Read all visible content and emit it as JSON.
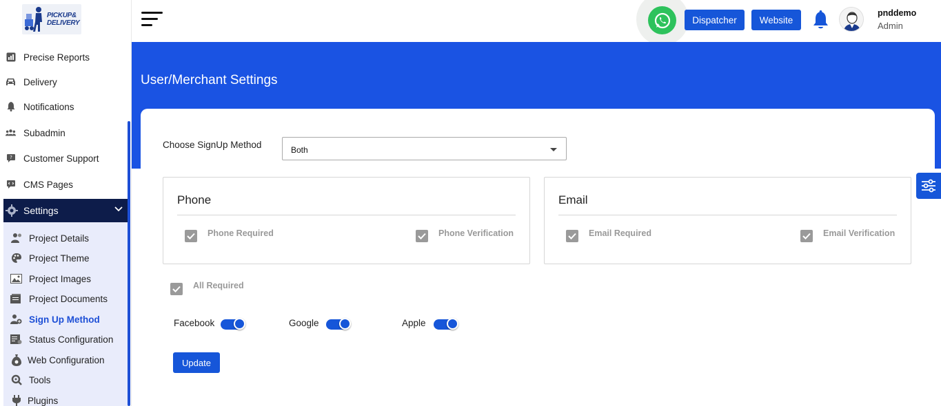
{
  "logo": {
    "line1": "PICKUP&",
    "line2": "DELIVERY"
  },
  "sidebar": {
    "items": [
      {
        "label": "Precise Reports",
        "icon": "reports-icon"
      },
      {
        "label": "Delivery",
        "icon": "car-icon"
      },
      {
        "label": "Notifications",
        "icon": "bell-icon"
      },
      {
        "label": "Subadmin",
        "icon": "users-icon"
      },
      {
        "label": "Customer Support",
        "icon": "support-icon"
      },
      {
        "label": "CMS Pages",
        "icon": "cms-icon"
      }
    ],
    "settings": {
      "label": "Settings",
      "icon": "gear-icon"
    },
    "submenu": [
      {
        "label": "Project Details",
        "icon": "user-gear-icon"
      },
      {
        "label": "Project Theme",
        "icon": "palette-icon"
      },
      {
        "label": "Project Images",
        "icon": "image-icon"
      },
      {
        "label": "Project Documents",
        "icon": "documents-icon"
      },
      {
        "label": "Sign Up Method",
        "icon": "signup-icon",
        "active": true
      },
      {
        "label": "Status Configuration",
        "icon": "status-icon"
      },
      {
        "label": "Web Configuration",
        "icon": "web-config-icon"
      },
      {
        "label": "Tools",
        "icon": "tools-icon"
      },
      {
        "label": "Plugins",
        "icon": "plug-icon"
      }
    ]
  },
  "header": {
    "dispatcher_label": "Dispatcher",
    "website_label": "Website",
    "user": {
      "name": "pnddemo",
      "role": "Admin"
    }
  },
  "page": {
    "title": "User/Merchant Settings",
    "signup_label": "Choose SignUp Method",
    "signup_value": "Both",
    "phone": {
      "title": "Phone",
      "required_label": "Phone Required",
      "verification_label": "Phone Verification",
      "required_checked": true,
      "verification_checked": true
    },
    "email": {
      "title": "Email",
      "required_label": "Email Required",
      "verification_label": "Email Verification",
      "required_checked": true,
      "verification_checked": true
    },
    "all_required_label": "All Required",
    "all_required_checked": true,
    "social": [
      {
        "label": "Facebook",
        "enabled": true
      },
      {
        "label": "Google",
        "enabled": true
      },
      {
        "label": "Apple",
        "enabled": true
      }
    ],
    "update_label": "Update"
  },
  "colors": {
    "primary": "#1656d9",
    "banner": "#1a53e3",
    "sidebar_active_bg": "#0d1c4a",
    "submenu_bg": "#e9ecfb",
    "whatsapp": "#2dc25c"
  }
}
